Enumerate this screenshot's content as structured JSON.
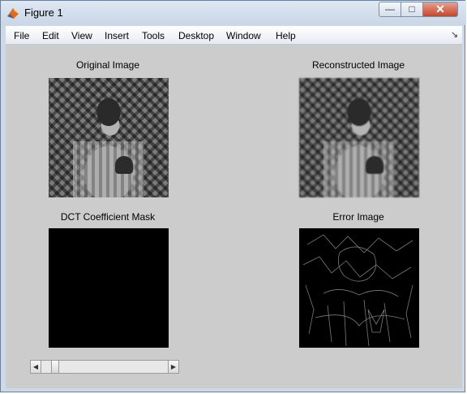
{
  "window": {
    "title": "Figure 1",
    "buttons": {
      "minimize": "—",
      "maximize": "□",
      "close": "✕"
    }
  },
  "menubar": {
    "items": [
      "File",
      "Edit",
      "View",
      "Insert",
      "Tools",
      "Desktop",
      "Window",
      "Help"
    ],
    "dock_icon": "↘"
  },
  "figure": {
    "panels": [
      {
        "title": "Original Image",
        "icon": "photo-image"
      },
      {
        "title": "Reconstructed Image",
        "icon": "photo-image"
      },
      {
        "title": "DCT Coefficient Mask",
        "icon": "mask-image"
      },
      {
        "title": "Error Image",
        "icon": "error-image"
      }
    ],
    "slider": {
      "value_fraction": 0.09,
      "left_arrow": "◀",
      "right_arrow": "▶"
    }
  },
  "colors": {
    "figure_background": "#cccccc",
    "titlebar": "#d4deea",
    "close_button": "#c7442b"
  }
}
